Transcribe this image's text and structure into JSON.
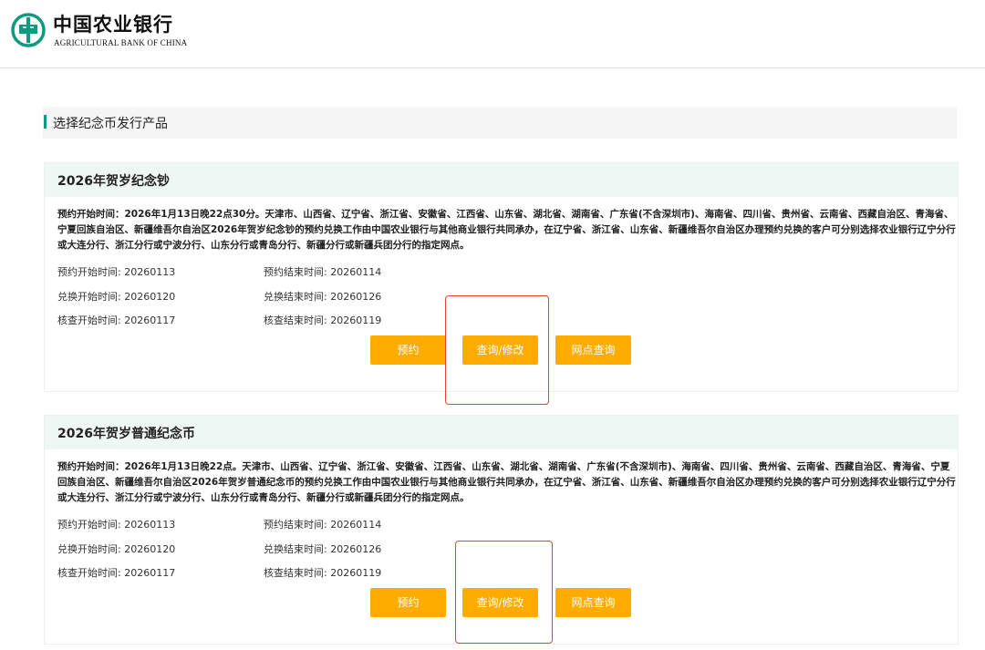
{
  "header": {
    "logo_cn": "中国农业银行",
    "logo_en": "AGRICULTURAL BANK OF CHINA",
    "brand_color": "#0f9a7f"
  },
  "section": {
    "title": "选择纪念币发行产品"
  },
  "products": [
    {
      "name": "2026年贺岁纪念钞",
      "description": "预约开始时间：2026年1月13日晚22点30分。天津市、山西省、辽宁省、浙江省、安徽省、江西省、山东省、湖北省、湖南省、广东省(不含深圳市)、海南省、四川省、贵州省、云南省、西藏自治区、青海省、宁夏回族自治区、新疆维吾尔自治区2026年贺岁纪念钞的预约兑换工作由中国农业银行与其他商业银行共同承办，在辽宁省、浙江省、山东省、新疆维吾尔自治区办理预约兑换的客户可分别选择农业银行辽宁分行或大连分行、浙江分行或宁波分行、山东分行或青岛分行、新疆分行或新疆兵团分行的指定网点。",
      "reserve_start": "预约开始时间: 20260113",
      "reserve_end": "预约结束时间: 20260114",
      "exchange_start": "兑换开始时间: 20260120",
      "exchange_end": "兑换结束时间: 20260126",
      "check_start": "核查开始时间: 20260117",
      "check_end": "核查结束时间: 20260119",
      "buttons": {
        "reserve": "预约",
        "query": "查询/修改",
        "outlet": "网点查询"
      }
    },
    {
      "name": "2026年贺岁普通纪念币",
      "description": "预约开始时间：2026年1月13日晚22点。天津市、山西省、辽宁省、浙江省、安徽省、江西省、山东省、湖北省、湖南省、广东省(不含深圳市)、海南省、四川省、贵州省、云南省、西藏自治区、青海省、宁夏回族自治区、新疆维吾尔自治区2026年贺岁普通纪念币的预约兑换工作由中国农业银行与其他商业银行共同承办，在辽宁省、浙江省、山东省、新疆维吾尔自治区办理预约兑换的客户可分别选择农业银行辽宁分行或大连分行、浙江分行或宁波分行、山东分行或青岛分行、新疆分行或新疆兵团分行的指定网点。",
      "reserve_start": "预约开始时间: 20260113",
      "reserve_end": "预约结束时间: 20260114",
      "exchange_start": "兑换开始时间: 20260120",
      "exchange_end": "兑换结束时间: 20260126",
      "check_start": "核查开始时间: 20260117",
      "check_end": "核查结束时间: 20260119",
      "buttons": {
        "reserve": "预约",
        "query": "查询/修改",
        "outlet": "网点查询"
      }
    }
  ],
  "colors": {
    "button": "#ffab00",
    "highlight": "#e0462f",
    "card_header": "#eef7f4"
  }
}
